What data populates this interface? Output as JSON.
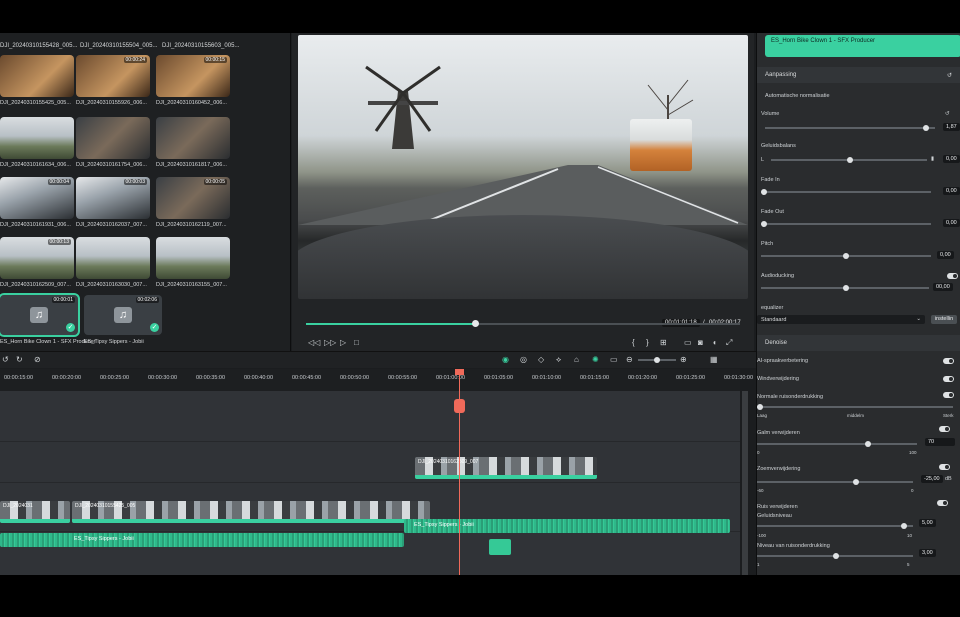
{
  "bin": {
    "top_labels": [
      "DJI_20240310155428_005...",
      "DJI_20240310155504_005...",
      "DJI_20240310155603_005..."
    ],
    "items": [
      {
        "label": "DJI_20240310155425_005...",
        "duration": "",
        "style": "interior"
      },
      {
        "label": "DJI_20240310155926_006...",
        "duration": "00:00:24",
        "style": "interior"
      },
      {
        "label": "DJI_20240310160452_006...",
        "duration": "00:00:15",
        "style": "interior"
      },
      {
        "label": "DJI_20240310161634_006...",
        "duration": "",
        "style": "road"
      },
      {
        "label": "DJI_20240310161754_006...",
        "duration": "",
        "style": "face"
      },
      {
        "label": "DJI_20240310161817_006...",
        "duration": "",
        "style": "face"
      },
      {
        "label": "DJI_20240310161931_006...",
        "duration": "00:00:04",
        "style": "car"
      },
      {
        "label": "DJI_20240310162037_007...",
        "duration": "00:00:03",
        "style": "car"
      },
      {
        "label": "DJI_20240310162119_007...",
        "duration": "00:00:05",
        "style": "face"
      },
      {
        "label": "DJI_20240310162509_007...",
        "duration": "00:00:13",
        "style": "road"
      },
      {
        "label": "DJI_20240310163030_007...",
        "duration": "",
        "style": "road"
      },
      {
        "label": "DJI_20240310163155_007...",
        "duration": "",
        "style": "road"
      },
      {
        "label": "ES_Horn Bike Clown 1 - SFX Producer",
        "duration": "00:00:01",
        "style": "audio"
      },
      {
        "label": "ES_Tipsy Sippers - Jobii",
        "duration": "00:02:06",
        "style": "audio"
      }
    ]
  },
  "preview": {
    "current_time": "00:01:01:18",
    "separator": "/",
    "total_time": "00:02:00:17",
    "progress": 0.39
  },
  "timeline": {
    "ruler_ticks": [
      "00:00:15:00",
      "00:00:20:00",
      "00:00:25:00",
      "00:00:30:00",
      "00:00:35:00",
      "00:00:40:00",
      "00:00:45:00",
      "00:00:50:00",
      "00:00:55:00",
      "00:01:00:00",
      "00:01:05:00",
      "00:01:10:00",
      "00:01:15:00",
      "00:01:20:00",
      "00:01:25:00",
      "00:01:30:00"
    ],
    "clip_upper": "DJI_20240310162509_007",
    "clip_main_1": "DJI_2024031",
    "clip_main_2": "DJI_20240310155425_005",
    "audio_1": "ES_Tipsy Sippers - Jobii",
    "audio_2": "ES_Tipsy Sippers - Jobii"
  },
  "panel": {
    "clip_title": "ES_Horn Bike Clown 1 - SFX Producer",
    "section_adjust": "Aanpassing",
    "auto_normalize": "Automatische normalisatie",
    "volume_label": "Volume",
    "volume_value": "1,87",
    "balance_label": "Geluidsbalans",
    "balance_l": "L",
    "balance_value": "0,00",
    "fade_in_label": "Fade In",
    "fade_in_value": "0,00",
    "fade_out_label": "Fade Out",
    "fade_out_value": "0,00",
    "pitch_label": "Pitch",
    "pitch_value": "0,00",
    "ducking_label": "Audioducking",
    "ducking_value": "00,00",
    "equalizer_label": "equalizer",
    "equalizer_value": "Standaard",
    "equalizer_button": "instellin",
    "section_denoise": "Denoise",
    "ai_voice": "AI-spraakverbetering",
    "wind": "Windverwijdering",
    "normal_noise": "Normale ruisonderdrukking",
    "weak": "Laag",
    "medium": "middelm",
    "strong": "Sterk",
    "hum_label": "Galm verwijderen",
    "hum_value": "70",
    "hum_min": "0",
    "hum_max": "100",
    "hiss_label": "Zoemverwijdering",
    "hiss_value": "-25,00",
    "hiss_unit": "dB",
    "hiss_min": "-60",
    "hiss_max": "0",
    "noise_removal": "Ruis verwijderen",
    "noise_type": "Geluidsniveau",
    "noise_value": "5,00",
    "noise_min": "-100",
    "noise_max": "10",
    "noise_level_label": "Niveau van ruisonderdrukking",
    "noise_level_value": "3,00",
    "noise_level_min": "1",
    "noise_level_max": "5"
  }
}
